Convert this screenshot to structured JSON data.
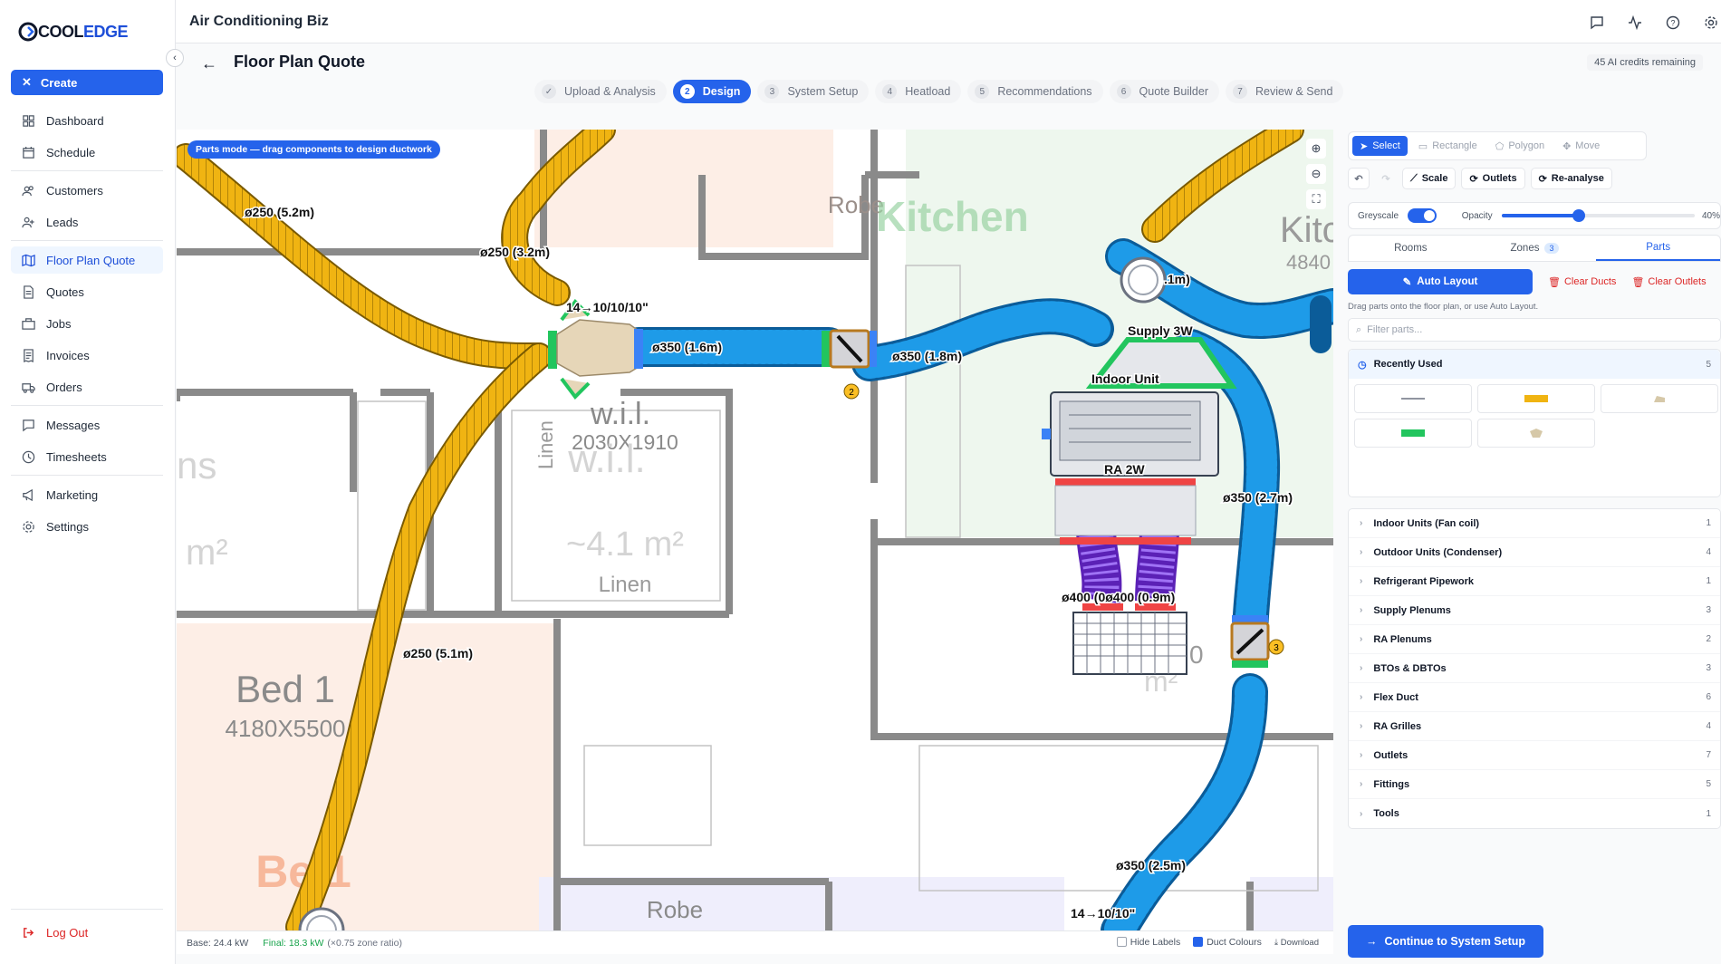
{
  "sidebar": {
    "logo": {
      "part1": "COOL",
      "part2": "EDGE"
    },
    "create_label": "Create",
    "items": [
      {
        "label": "Dashboard",
        "icon": "grid-icon"
      },
      {
        "label": "Schedule",
        "icon": "calendar-icon"
      },
      {
        "label": "Customers",
        "icon": "users-icon"
      },
      {
        "label": "Leads",
        "icon": "user-plus-icon"
      },
      {
        "label": "Floor Plan Quote",
        "icon": "map-icon"
      },
      {
        "label": "Quotes",
        "icon": "file-icon"
      },
      {
        "label": "Jobs",
        "icon": "briefcase-icon"
      },
      {
        "label": "Invoices",
        "icon": "receipt-icon"
      },
      {
        "label": "Orders",
        "icon": "truck-icon"
      },
      {
        "label": "Messages",
        "icon": "message-icon"
      },
      {
        "label": "Timesheets",
        "icon": "clock-icon"
      },
      {
        "label": "Marketing",
        "icon": "megaphone-icon"
      },
      {
        "label": "Settings",
        "icon": "gear-icon"
      }
    ],
    "active": "Floor Plan Quote",
    "logout_label": "Log Out"
  },
  "topbar": {
    "title": "Air Conditioning Biz"
  },
  "header": {
    "title": "Floor Plan Quote",
    "credits": "45 AI credits remaining"
  },
  "steps": [
    {
      "num": "✓",
      "label": "Upload & Analysis"
    },
    {
      "num": "2",
      "label": "Design"
    },
    {
      "num": "3",
      "label": "System Setup"
    },
    {
      "num": "4",
      "label": "Heatload"
    },
    {
      "num": "5",
      "label": "Recommendations"
    },
    {
      "num": "6",
      "label": "Quote Builder"
    },
    {
      "num": "7",
      "label": "Review & Send"
    }
  ],
  "canvas": {
    "mode_pill": "Parts mode — drag components to design ductwork",
    "rooms": {
      "robe_top": "Robe",
      "kitchen_ghost": "Kitchen",
      "kitchen2": "Kitc",
      "kitchen2_dim": "4840",
      "wil": "w.i.l.",
      "wil_dim": "2030X1910",
      "wil_ghost": "w.i.l.",
      "linen_vert": "Linen",
      "area_ghost": "~4.1 m²",
      "linen": "Linen",
      "ns_ghost": "ns",
      "m2_ghost": "m²",
      "bed1": "Bed 1",
      "bed1_dim": "4180X5500",
      "bed1_ghost": "Be  1",
      "robe_bottom": "Robe",
      "zero_ghost": "0",
      "m2_ghost2": "m²"
    },
    "labels": {
      "d1": "ø250 (5.2m)",
      "d2": "ø250 (3.2m)",
      "d3": "14→10/10/10\"",
      "d4": "ø350 (1.6m)",
      "d5": "ø350 (1.8m)",
      "d6": ".1m)",
      "d7": "Supply 3W",
      "d8": "Indoor Unit",
      "d9": "RA 2W",
      "d10": "ø350 (2.7m)",
      "d11": "ø400 (0ø400 (0.9m)",
      "d12": "ø250 (5.1m)",
      "d13": "ø350 (2.5m)",
      "d14": "14→10/10\"",
      "damper1_badge": "2",
      "damper2_badge": "3"
    }
  },
  "statusbar": {
    "base": "Base: 24.4 kW",
    "final": "Final: 18.3 kW",
    "ratio": "(×0.75 zone ratio)",
    "hide_labels": "Hide Labels",
    "duct_colours": "Duct Colours",
    "download": "Download"
  },
  "panel": {
    "tools": [
      "Select",
      "Rectangle",
      "Polygon",
      "Move"
    ],
    "scale": "Scale",
    "outlets": "Outlets",
    "reanalyse": "Re-analyse",
    "greyscale": "Greyscale",
    "opacity": "Opacity",
    "opacity_value": "40%",
    "opacity_fraction": 0.4,
    "tabs": [
      {
        "label": "Rooms"
      },
      {
        "label": "Zones",
        "badge": "3"
      },
      {
        "label": "Parts"
      }
    ],
    "auto_layout": "Auto Layout",
    "clear_ducts": "Clear Ducts",
    "clear_outlets": "Clear Outlets",
    "hint": "Drag parts onto the floor plan, or use Auto Layout.",
    "filter_placeholder": "Filter parts...",
    "recent_label": "Recently Used",
    "recent_count": "5",
    "categories": [
      {
        "label": "Indoor Units (Fan coil)",
        "count": "1"
      },
      {
        "label": "Outdoor Units (Condenser)",
        "count": "4"
      },
      {
        "label": "Refrigerant Pipework",
        "count": "1"
      },
      {
        "label": "Supply Plenums",
        "count": "3"
      },
      {
        "label": "RA Plenums",
        "count": "2"
      },
      {
        "label": "BTOs & DBTOs",
        "count": "3"
      },
      {
        "label": "Flex Duct",
        "count": "6"
      },
      {
        "label": "RA Grilles",
        "count": "4"
      },
      {
        "label": "Outlets",
        "count": "7"
      },
      {
        "label": "Fittings",
        "count": "5"
      },
      {
        "label": "Tools",
        "count": "1"
      }
    ],
    "continue": "Continue to System Setup"
  },
  "colors": {
    "accent": "#2563eb",
    "supply_duct": "#1e9be8",
    "branch_duct": "#f0b412",
    "return_duct": "#8b5cf6",
    "danger": "#dc2626"
  }
}
